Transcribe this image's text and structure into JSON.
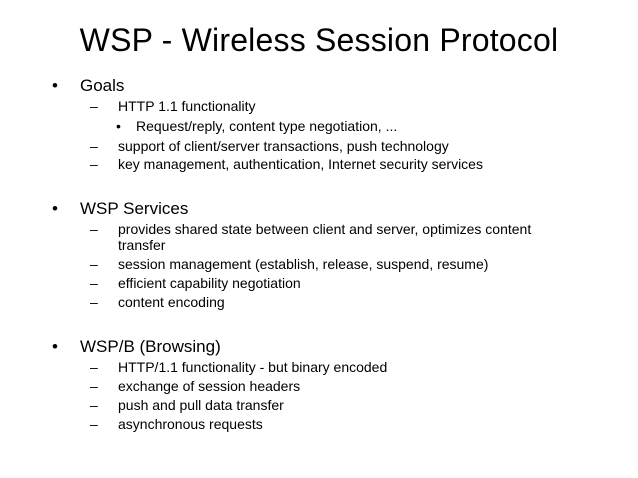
{
  "title": "WSP - Wireless Session Protocol",
  "sections": [
    {
      "heading": "Goals",
      "items": [
        "HTTP 1.1 functionality",
        "Request/reply, content type negotiation, ...",
        "support of client/server transactions, push technology",
        "key management, authentication, Internet security services"
      ]
    },
    {
      "heading": "WSP Services",
      "items": [
        "provides shared state between client and server, optimizes content",
        "transfer",
        "session management (establish, release, suspend, resume)",
        "efficient capability negotiation",
        "content encoding"
      ]
    },
    {
      "heading": "WSP/B (Browsing)",
      "items": [
        "HTTP/1.1 functionality - but binary encoded",
        "exchange of session headers",
        "push and pull data transfer",
        "asynchronous requests"
      ]
    }
  ],
  "markers": {
    "bullet": "•",
    "dash": "–"
  }
}
